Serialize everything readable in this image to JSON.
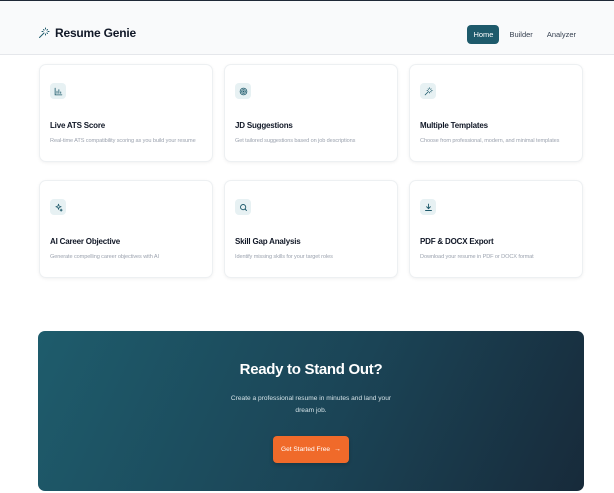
{
  "brand": {
    "name": "Resume Genie",
    "icon": "magic-wand-icon"
  },
  "nav": {
    "items": [
      {
        "label": "Home",
        "active": true
      },
      {
        "label": "Builder",
        "active": false
      },
      {
        "label": "Analyzer",
        "active": false
      }
    ]
  },
  "features": [
    {
      "icon": "bar-chart-icon",
      "title": "Live ATS Score",
      "description": "Real-time ATS compatibility scoring as you build your resume"
    },
    {
      "icon": "target-icon",
      "title": "JD Suggestions",
      "description": "Get tailored suggestions based on job descriptions"
    },
    {
      "icon": "magic-wand-icon",
      "title": "Multiple Templates",
      "description": "Choose from professional, modern, and minimal templates"
    },
    {
      "icon": "sparkles-icon",
      "title": "AI Career Objective",
      "description": "Generate compelling career objectives with AI"
    },
    {
      "icon": "search-icon",
      "title": "Skill Gap Analysis",
      "description": "Identify missing skills for your target roles"
    },
    {
      "icon": "download-icon",
      "title": "PDF & DOCX Export",
      "description": "Download your resume in PDF or DOCX format"
    }
  ],
  "cta": {
    "title": "Ready to Stand Out?",
    "subtitle": "Create a professional resume in minutes and land your dream job.",
    "button_label": "Get Started Free",
    "button_icon": "arrow-right-icon"
  },
  "colors": {
    "primary": "#1e5a6b",
    "accent": "#f06a2a",
    "icon_bg": "#e7f1f3"
  }
}
